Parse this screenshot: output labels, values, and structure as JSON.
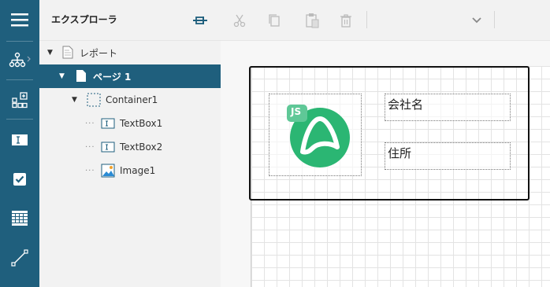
{
  "explorer": {
    "title": "エクスプローラ",
    "tree": [
      {
        "label": "レポート",
        "level": 0,
        "expanded": true,
        "icon": "report-doc-icon"
      },
      {
        "label": "ページ 1",
        "level": 1,
        "expanded": true,
        "selected": true,
        "icon": "page-icon"
      },
      {
        "label": "Container1",
        "level": 2,
        "expanded": true,
        "icon": "container-icon"
      },
      {
        "label": "TextBox1",
        "level": 3,
        "icon": "textbox-icon"
      },
      {
        "label": "TextBox2",
        "level": 3,
        "icon": "textbox-icon"
      },
      {
        "label": "Image1",
        "level": 3,
        "icon": "image-icon"
      }
    ]
  },
  "toolbar": {
    "icons": [
      "pin-icon",
      "scissors-icon",
      "copy-icon",
      "paste-icon",
      "trash-icon",
      "chevron-down-icon"
    ]
  },
  "rail": {
    "icons": [
      "hamburger-menu-icon",
      "hierarchy-icon",
      "add-control-icon",
      "textbox-tool-icon",
      "checkbox-tool-icon",
      "table-tool-icon",
      "line-tool-icon"
    ]
  },
  "canvas": {
    "textbox1": "会社名",
    "textbox2": "住所",
    "image_badge": "JS"
  },
  "colors": {
    "accent": "#1f5f7d",
    "logo_green": "#2bb673"
  }
}
